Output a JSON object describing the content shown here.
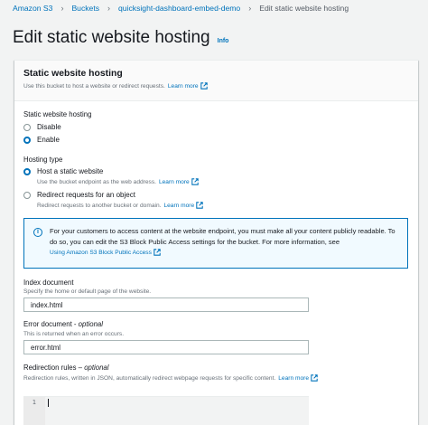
{
  "breadcrumb": {
    "items": [
      "Amazon S3",
      "Buckets",
      "quicksight-dashboard-embed-demo"
    ],
    "current": "Edit static website hosting"
  },
  "page": {
    "title": "Edit static website hosting",
    "info": "Info"
  },
  "panel": {
    "title": "Static website hosting",
    "description": "Use this bucket to host a website or redirect requests.",
    "learn_more": "Learn more"
  },
  "hosting_toggle": {
    "label": "Static website hosting",
    "options": [
      "Disable",
      "Enable"
    ],
    "selected": "Enable"
  },
  "hosting_type": {
    "label": "Hosting type",
    "host_option": "Host a static website",
    "host_desc": "Use the bucket endpoint as the web address.",
    "redirect_option": "Redirect requests for an object",
    "redirect_desc": "Redirect requests to another bucket or domain.",
    "learn_more": "Learn more",
    "selected": "Host a static website"
  },
  "alert": {
    "text": "For your customers to access content at the website endpoint, you must make all your content publicly readable. To do so, you can edit the S3 Block Public Access settings for the bucket. For more information, see",
    "link": "Using Amazon S3 Block Public Access"
  },
  "index_document": {
    "label": "Index document",
    "description": "Specify the home or default page of the website.",
    "value": "index.html"
  },
  "error_document": {
    "label": "Error document",
    "optional": "optional",
    "description": "This is returned when an error occurs.",
    "value": "error.html"
  },
  "redirection_rules": {
    "label": "Redirection rules",
    "optional": "optional",
    "description": "Redirection rules, written in JSON, automatically redirect webpage requests for specific content.",
    "learn_more": "Learn more",
    "line_number": "1"
  },
  "colors": {
    "link": "#0073bb",
    "background": "#f2f3f3",
    "alert_bg": "#f1faff"
  }
}
